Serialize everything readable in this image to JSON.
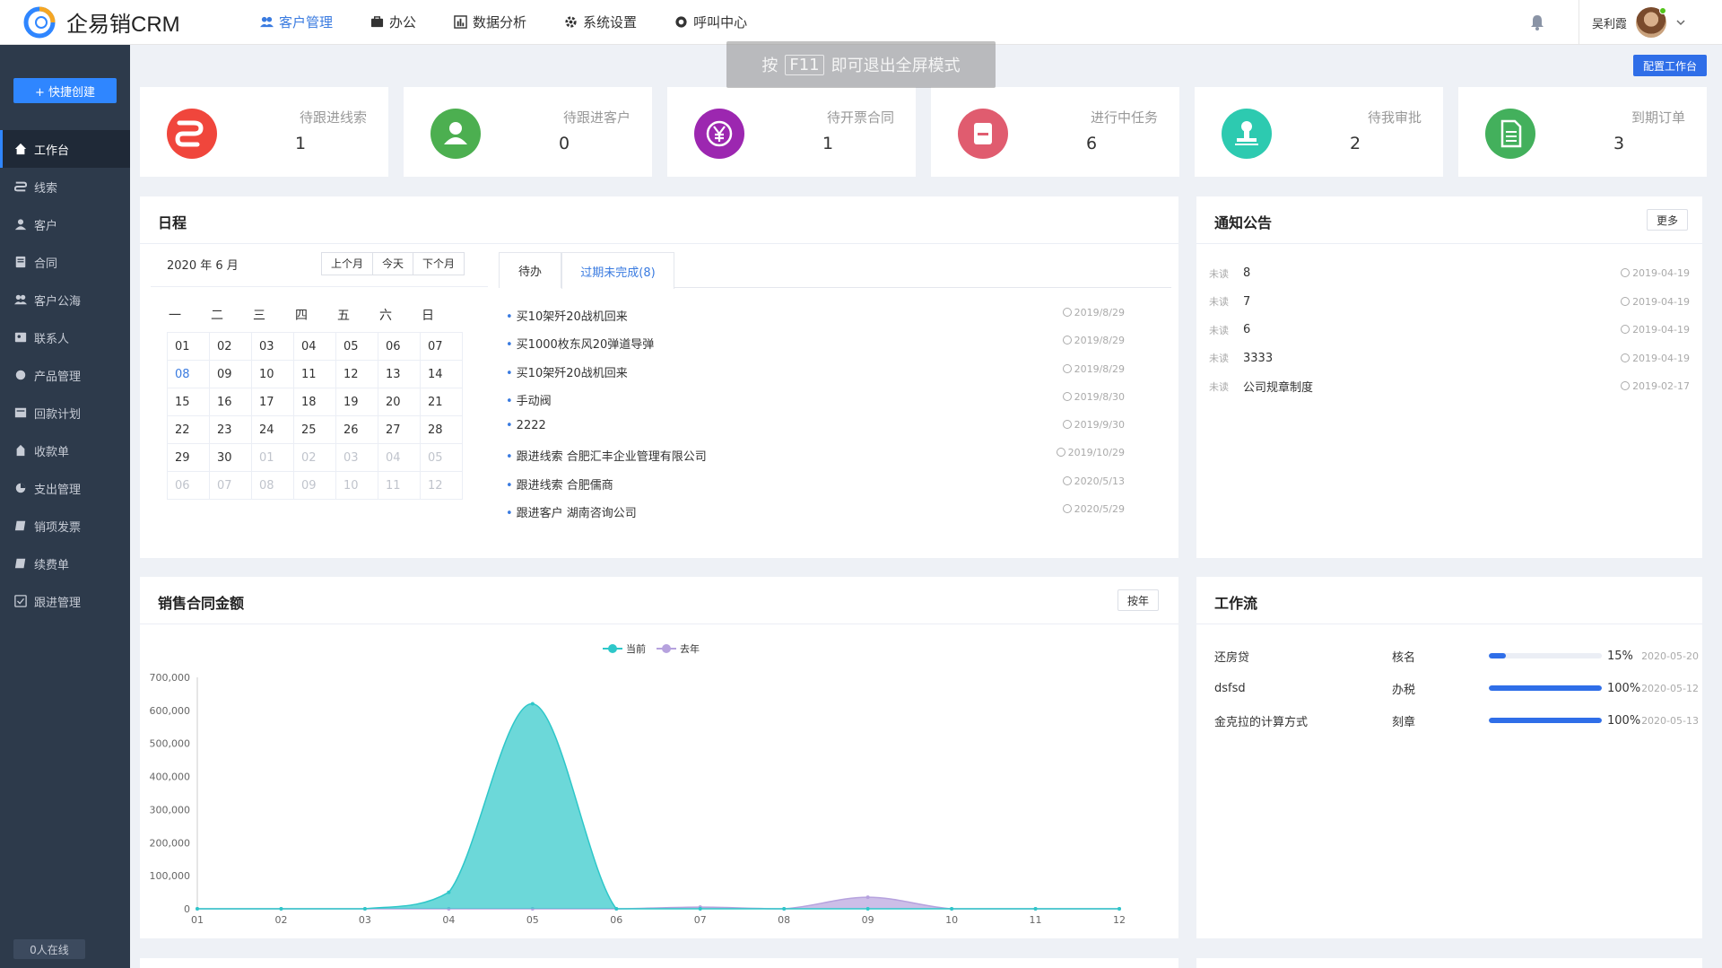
{
  "app": {
    "title": "企易销CRM",
    "logo_icon": "crm-logo-icon"
  },
  "topnav": [
    {
      "label": "客户管理",
      "icon": "users-icon",
      "active": true
    },
    {
      "label": "办公",
      "icon": "briefcase-icon",
      "active": false
    },
    {
      "label": "数据分析",
      "icon": "chart-icon",
      "active": false
    },
    {
      "label": "系统设置",
      "icon": "gear-icon",
      "active": false
    },
    {
      "label": "呼叫中心",
      "icon": "headset-icon",
      "active": false
    }
  ],
  "user": {
    "name": "吴利霞"
  },
  "fullscreen_hint": {
    "prefix": "按",
    "key": "F11",
    "suffix": "即可退出全屏模式"
  },
  "sidebar": {
    "quick_create": "+ 快捷创建",
    "online": "0人在线",
    "items": [
      {
        "label": "工作台",
        "icon": "home-icon",
        "active": true
      },
      {
        "label": "线索",
        "icon": "lead-icon"
      },
      {
        "label": "客户",
        "icon": "person-icon"
      },
      {
        "label": "合同",
        "icon": "contract-icon"
      },
      {
        "label": "客户公海",
        "icon": "group-icon"
      },
      {
        "label": "联系人",
        "icon": "contact-icon"
      },
      {
        "label": "产品管理",
        "icon": "product-icon"
      },
      {
        "label": "回款计划",
        "icon": "plan-icon"
      },
      {
        "label": "收款单",
        "icon": "receipt-icon"
      },
      {
        "label": "支出管理",
        "icon": "expense-icon"
      },
      {
        "label": "销项发票",
        "icon": "invoice-icon"
      },
      {
        "label": "续费单",
        "icon": "renew-icon"
      },
      {
        "label": "跟进管理",
        "icon": "followup-icon"
      }
    ]
  },
  "config_workspace": "配置工作台",
  "stats": [
    {
      "label": "待跟进线索",
      "value": "1",
      "color": "#f0463c",
      "icon": "lead-icon"
    },
    {
      "label": "待跟进客户",
      "value": "0",
      "color": "#4caf50",
      "icon": "person-icon"
    },
    {
      "label": "待开票合同",
      "value": "1",
      "color": "#9c27b0",
      "icon": "yen-icon"
    },
    {
      "label": "进行中任务",
      "value": "6",
      "color": "#e05c6f",
      "icon": "task-icon"
    },
    {
      "label": "待我审批",
      "value": "2",
      "color": "#2dcab0",
      "icon": "stamp-icon"
    },
    {
      "label": "到期订单",
      "value": "3",
      "color": "#43b05c",
      "icon": "document-icon"
    }
  ],
  "schedule": {
    "title": "日程",
    "month_label": "2020 年 6 月",
    "nav": [
      "上个月",
      "今天",
      "下个月"
    ],
    "weekdays": [
      "一",
      "二",
      "三",
      "四",
      "五",
      "六",
      "日"
    ],
    "weeks": [
      [
        {
          "d": "01"
        },
        {
          "d": "02"
        },
        {
          "d": "03"
        },
        {
          "d": "04"
        },
        {
          "d": "05"
        },
        {
          "d": "06"
        },
        {
          "d": "07"
        }
      ],
      [
        {
          "d": "08",
          "today": true
        },
        {
          "d": "09"
        },
        {
          "d": "10"
        },
        {
          "d": "11"
        },
        {
          "d": "12"
        },
        {
          "d": "13"
        },
        {
          "d": "14"
        }
      ],
      [
        {
          "d": "15"
        },
        {
          "d": "16"
        },
        {
          "d": "17"
        },
        {
          "d": "18"
        },
        {
          "d": "19"
        },
        {
          "d": "20"
        },
        {
          "d": "21"
        }
      ],
      [
        {
          "d": "22"
        },
        {
          "d": "23"
        },
        {
          "d": "24"
        },
        {
          "d": "25"
        },
        {
          "d": "26"
        },
        {
          "d": "27"
        },
        {
          "d": "28"
        }
      ],
      [
        {
          "d": "29"
        },
        {
          "d": "30"
        },
        {
          "d": "01",
          "dim": true
        },
        {
          "d": "02",
          "dim": true
        },
        {
          "d": "03",
          "dim": true
        },
        {
          "d": "04",
          "dim": true
        },
        {
          "d": "05",
          "dim": true
        }
      ],
      [
        {
          "d": "06",
          "dim": true
        },
        {
          "d": "07",
          "dim": true
        },
        {
          "d": "08",
          "dim": true
        },
        {
          "d": "09",
          "dim": true
        },
        {
          "d": "10",
          "dim": true
        },
        {
          "d": "11",
          "dim": true
        },
        {
          "d": "12",
          "dim": true
        }
      ]
    ],
    "tabs": [
      {
        "label": "待办"
      },
      {
        "label": "过期未完成(8)",
        "active": true
      }
    ],
    "tasks": [
      {
        "title": "买10架歼20战机回来",
        "date": "2019/8/29"
      },
      {
        "title": "买1000枚东风20弹道导弹",
        "date": "2019/8/29"
      },
      {
        "title": "买10架歼20战机回来",
        "date": "2019/8/29"
      },
      {
        "title": "手动阀",
        "date": "2019/8/30"
      },
      {
        "title": "2222",
        "date": "2019/9/30"
      },
      {
        "title": "跟进线索 合肥汇丰企业管理有限公司",
        "date": "2019/10/29"
      },
      {
        "title": "跟进线索 合肥儒商",
        "date": "2020/5/13"
      },
      {
        "title": "跟进客户 湖南咨询公司",
        "date": "2020/5/29"
      }
    ]
  },
  "notice": {
    "title": "通知公告",
    "more": "更多",
    "items": [
      {
        "status": "未读",
        "title": "8",
        "date": "2019-04-19"
      },
      {
        "status": "未读",
        "title": "7",
        "date": "2019-04-19"
      },
      {
        "status": "未读",
        "title": "6",
        "date": "2019-04-19"
      },
      {
        "status": "未读",
        "title": "3333",
        "date": "2019-04-19"
      },
      {
        "status": "未读",
        "title": "公司规章制度",
        "date": "2019-02-17"
      }
    ]
  },
  "sales": {
    "title": "销售合同金额",
    "by_year": "按年"
  },
  "chart_data": {
    "type": "area",
    "categories": [
      "01",
      "02",
      "03",
      "04",
      "05",
      "06",
      "07",
      "08",
      "09",
      "10",
      "11",
      "12"
    ],
    "series": [
      {
        "name": "当前",
        "color": "#2ec7c9",
        "values": [
          0,
          0,
          0,
          50000,
          620000,
          0,
          0,
          0,
          0,
          0,
          0,
          0
        ]
      },
      {
        "name": "去年",
        "color": "#b6a2de",
        "values": [
          0,
          0,
          0,
          0,
          0,
          0,
          5000,
          0,
          35000,
          0,
          0,
          0
        ]
      }
    ],
    "yticks": [
      "0",
      "100,000",
      "200,000",
      "300,000",
      "400,000",
      "500,000",
      "600,000",
      "700,000"
    ],
    "ylim": [
      0,
      700000
    ],
    "legend": "top-center",
    "grid": false
  },
  "workflow": {
    "title": "工作流",
    "items": [
      {
        "name": "还房贷",
        "step": "核名",
        "percent": 15,
        "percent_label": "15%",
        "date": "2020-05-20"
      },
      {
        "name": "dsfsd",
        "step": "办税",
        "percent": 100,
        "percent_label": "100%",
        "date": "2020-05-12"
      },
      {
        "name": "金克拉的计算方式",
        "step": "刻章",
        "percent": 100,
        "percent_label": "100%",
        "date": "2020-05-13"
      }
    ]
  }
}
